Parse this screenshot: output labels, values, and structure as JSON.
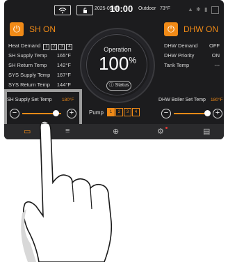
{
  "status_bar": {
    "date": "2025-09-08",
    "time": "10:00",
    "outdoor_label": "Outdoor",
    "outdoor_temp": "73°F",
    "icons": [
      "wifi-icon",
      "lock-icon",
      "warning-icon",
      "snowflake-icon",
      "device-icon",
      "grid-icon"
    ]
  },
  "sh": {
    "mode_label": "SH ON",
    "heat_demand_label": "Heat Demand",
    "zones": [
      "1",
      "2",
      "3",
      "4"
    ],
    "rows": [
      {
        "label": "SH Supply Temp",
        "value": "165°F"
      },
      {
        "label": "SH Return Temp",
        "value": "142°F"
      },
      {
        "label": "SYS Supply Temp",
        "value": "167°F"
      },
      {
        "label": "SYS Return Temp",
        "value": "144°F"
      }
    ],
    "set_label": "SH Supply Set Temp",
    "set_value": "180°F"
  },
  "dhw": {
    "mode_label": "DHW ON",
    "rows": [
      {
        "label": "DHW Demand",
        "value": "OFF"
      },
      {
        "label": "DHW Priority",
        "value": "ON"
      },
      {
        "label": "Tank Temp",
        "value": "---"
      }
    ],
    "set_label": "DHW Boiler Set Temp",
    "set_value": "180°F"
  },
  "center": {
    "operation_label": "Operation",
    "operation_value": "100",
    "percent": "%",
    "status_label": "Status"
  },
  "pump": {
    "label": "Pump",
    "boxes": [
      "1",
      "2",
      "3",
      "4"
    ]
  },
  "nav": {
    "icons": [
      "home-icon",
      "sliders-icon",
      "plus-circle-icon",
      "gear-icon",
      "document-icon"
    ]
  },
  "colors": {
    "accent": "#f08a17",
    "background": "#1c1c1e",
    "highlight_border": "#9e9e9e"
  },
  "slider_levels": {
    "sh": 0.8,
    "dhw": 0.8
  }
}
